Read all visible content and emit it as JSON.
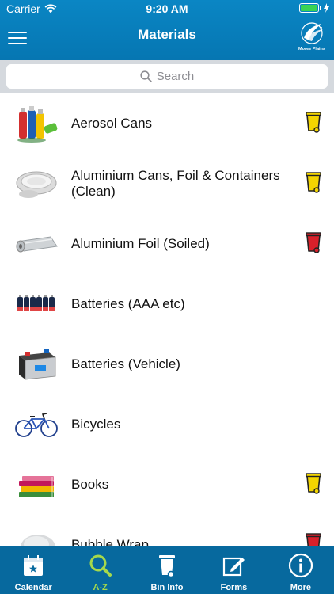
{
  "status_bar": {
    "carrier": "Carrier",
    "time": "9:20 AM"
  },
  "header": {
    "title": "Materials",
    "logo_text": "Moree Plains"
  },
  "search": {
    "placeholder": "Search"
  },
  "items": [
    {
      "label": "Aerosol Cans",
      "bin": "yellow"
    },
    {
      "label": "Aluminium Cans, Foil & Containers (Clean)",
      "bin": "yellow"
    },
    {
      "label": "Aluminium Foil (Soiled)",
      "bin": "red"
    },
    {
      "label": "Batteries (AAA etc)",
      "bin": ""
    },
    {
      "label": "Batteries (Vehicle)",
      "bin": ""
    },
    {
      "label": "Bicycles",
      "bin": ""
    },
    {
      "label": "Books",
      "bin": "yellow"
    },
    {
      "label": "Bubble Wrap",
      "bin": "red"
    }
  ],
  "tabs": [
    {
      "label": "Calendar",
      "icon": "calendar-icon"
    },
    {
      "label": "A-Z",
      "icon": "search-icon",
      "active": true
    },
    {
      "label": "Bin Info",
      "icon": "bin-icon"
    },
    {
      "label": "Forms",
      "icon": "forms-icon"
    },
    {
      "label": "More",
      "icon": "info-icon"
    }
  ],
  "colors": {
    "header": "#0a86c4",
    "tabbar": "#07699e",
    "active_tab": "#a5d94b",
    "bin_yellow": "#f3d500",
    "bin_red": "#d9202a"
  }
}
